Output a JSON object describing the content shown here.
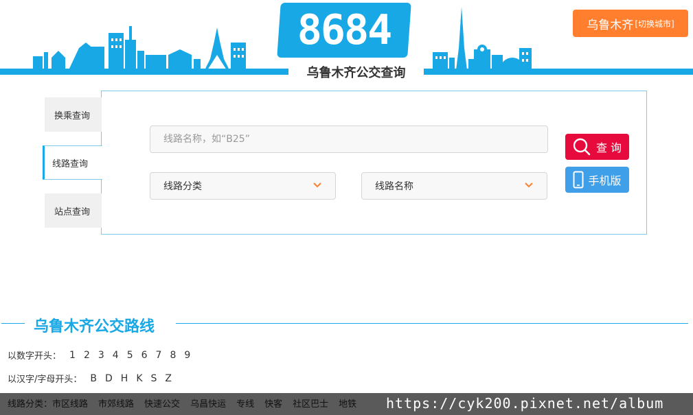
{
  "header": {
    "logo_text": "8684",
    "site_title": "乌鲁木齐公交查询",
    "city_name": "乌鲁木齐",
    "city_switch": "[切换城市]",
    "accent_color": "#18a8e6",
    "city_button_color": "#ff7f2f"
  },
  "tabs": [
    {
      "label": "换乘查询"
    },
    {
      "label": "线路查询"
    },
    {
      "label": "站点查询"
    }
  ],
  "search": {
    "line_placeholder": "线路名称，如“B25”",
    "select_category": "线路分类",
    "select_name": "线路名称",
    "search_label": "查 询",
    "mobile_label": "手机版",
    "search_color": "#e60b3c",
    "mobile_color": "#3f9fe8"
  },
  "routes": {
    "title": "乌鲁木齐公交路线",
    "digit_label": "以数字开头：",
    "digits": [
      "1",
      "2",
      "3",
      "4",
      "5",
      "6",
      "7",
      "8",
      "9"
    ],
    "letter_label": "以汉字/字母开头：",
    "letters": [
      "B",
      "D",
      "H",
      "K",
      "S",
      "Z"
    ],
    "category_label": "线路分类：",
    "categories": [
      "市区线路",
      "市郊线路",
      "快速公交",
      "乌昌快运",
      "专线",
      "快客",
      "社区巴士",
      "地铁"
    ]
  },
  "watermark": "https://cyk200.pixnet.net/album"
}
